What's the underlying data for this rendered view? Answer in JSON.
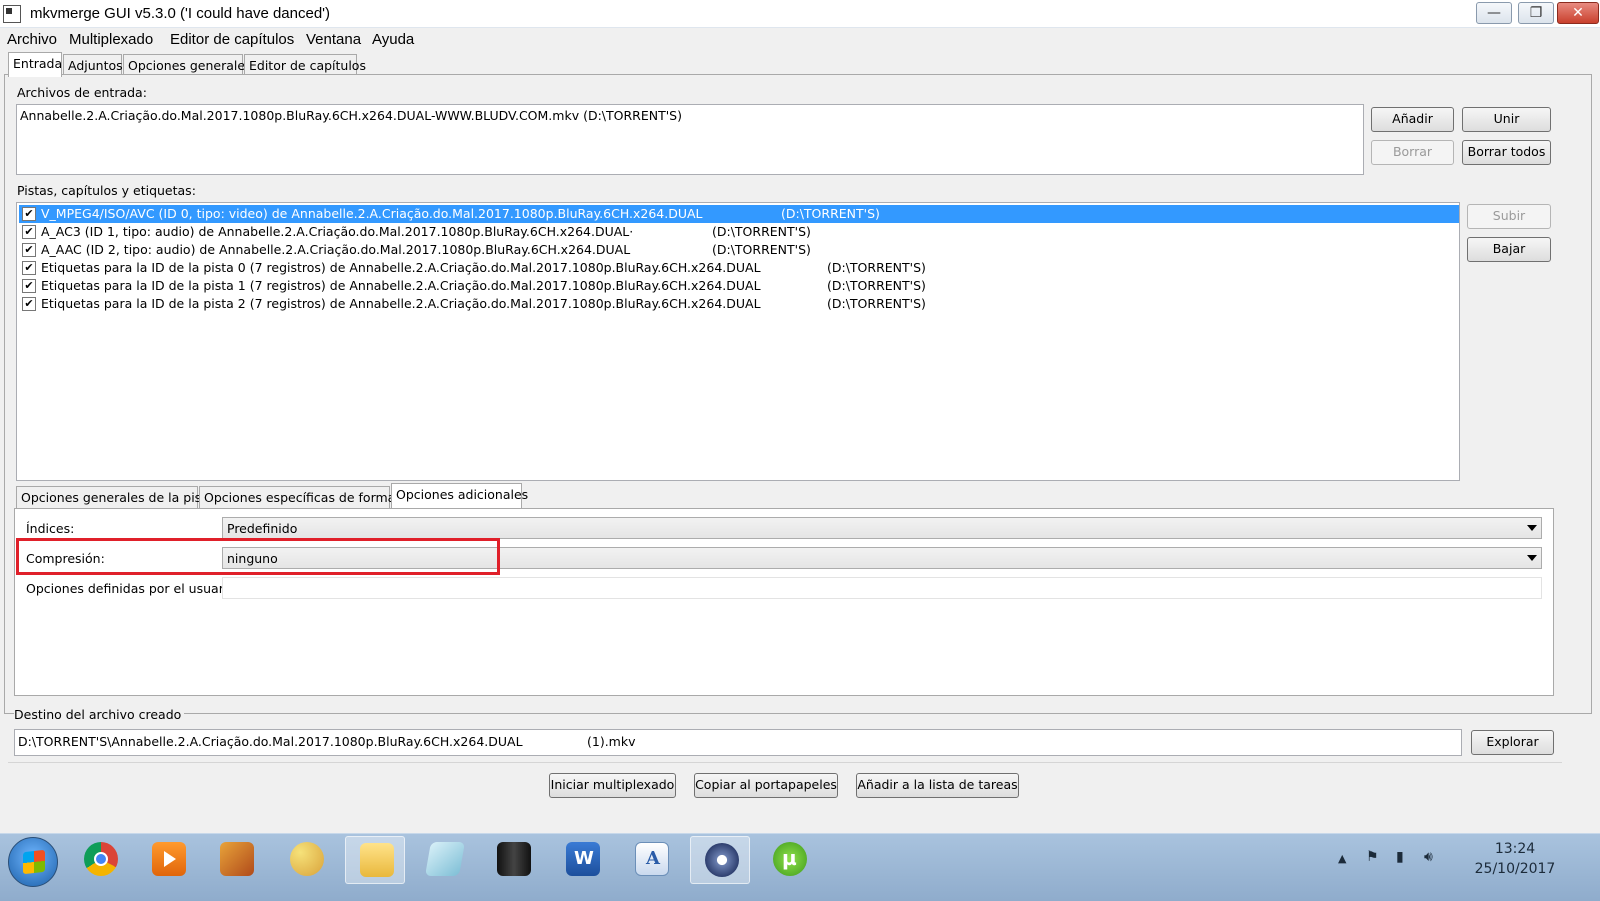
{
  "window": {
    "title": "mkvmerge GUI v5.3.0 ('I could have danced')",
    "minimize": "—",
    "maximize": "❐",
    "close": "✕"
  },
  "menu": [
    "Archivo",
    "Multiplexado",
    "Editor de capítulos",
    "Ventana",
    "Ayuda"
  ],
  "tabs": [
    "Entrada",
    "Adjuntos",
    "Opciones generales",
    "Editor de capítulos"
  ],
  "input": {
    "label": "Archivos de entrada:",
    "files": [
      "Annabelle.2.A.Criação.do.Mal.2017.1080p.BluRay.6CH.x264.DUAL-WWW.BLUDV.COM.mkv (D:\\TORRENT'S)"
    ],
    "buttons": {
      "add": "Añadir",
      "append": "Unir",
      "remove": "Borrar",
      "remove_all": "Borrar todos"
    }
  },
  "tracks": {
    "label": "Pistas, capítulos y etiquetas:",
    "rows": [
      {
        "text": "V_MPEG4/ISO/AVC (ID 0, tipo: video) de Annabelle.2.A.Criação.do.Mal.2017.1080p.BluRay.6CH.x264.DUAL",
        "path": "(D:\\TORRENT'S)",
        "checked": "✔"
      },
      {
        "text": "A_AC3 (ID 1, tipo: audio) de Annabelle.2.A.Criação.do.Mal.2017.1080p.BluRay.6CH.x264.DUAL·",
        "path": "(D:\\TORRENT'S)",
        "checked": "✔"
      },
      {
        "text": "A_AAC (ID 2, tipo: audio) de Annabelle.2.A.Criação.do.Mal.2017.1080p.BluRay.6CH.x264.DUAL",
        "path": "(D:\\TORRENT'S)",
        "checked": "✔"
      },
      {
        "text": "Etiquetas para la ID de la pista 0 (7 registros) de Annabelle.2.A.Criação.do.Mal.2017.1080p.BluRay.6CH.x264.DUAL",
        "path": "(D:\\TORRENT'S)",
        "checked": "✔"
      },
      {
        "text": "Etiquetas para la ID de la pista 1 (7 registros) de Annabelle.2.A.Criação.do.Mal.2017.1080p.BluRay.6CH.x264.DUAL",
        "path": "(D:\\TORRENT'S)",
        "checked": "✔"
      },
      {
        "text": "Etiquetas para la ID de la pista 2 (7 registros) de Annabelle.2.A.Criação.do.Mal.2017.1080p.BluRay.6CH.x264.DUAL",
        "path": "(D:\\TORRENT'S)",
        "checked": "✔"
      }
    ],
    "buttons": {
      "up": "Subir",
      "down": "Bajar"
    }
  },
  "subtabs": [
    "Opciones generales de la pista",
    "Opciones específicas de formato",
    "Opciones adicionales"
  ],
  "options": {
    "cues_label": "Índices:",
    "cues_value": "Predefinido",
    "compression_label": "Compresión:",
    "compression_value": "ninguno",
    "user_label": "Opciones definidas por el usuario:",
    "user_value": ""
  },
  "output": {
    "label": "Destino del archivo creado",
    "path": "D:\\TORRENT'S\\Annabelle.2.A.Criação.do.Mal.2017.1080p.BluRay.6CH.x264.DUAL",
    "suffix": "(1).mkv",
    "browse": "Explorar"
  },
  "actions": {
    "start": "Iniciar multiplexado",
    "copy": "Copiar al portapapeles",
    "queue": "Añadir a la lista de tareas"
  },
  "taskbar": {
    "apps": [
      "chrome-icon",
      "media-player-icon",
      "video-editor-icon",
      "paint-icon",
      "file-explorer-icon",
      "notepad-icon",
      "ps3-icon",
      "word-icon",
      "wordpad-icon",
      "mkvtoolnix-icon",
      "utorrent-icon"
    ],
    "time": "13:24",
    "date": "25/10/2017"
  },
  "colors": {
    "selection": "#3399ff",
    "highlight_box": "#e0202a",
    "taskbar": "#9db9d7"
  }
}
